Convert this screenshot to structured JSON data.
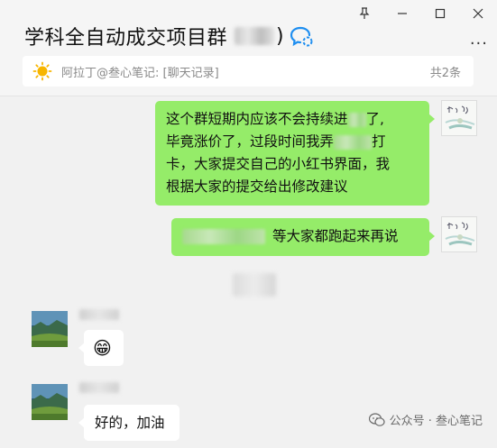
{
  "window": {
    "controls": [
      "pin-icon",
      "minimize-icon",
      "maximize-icon",
      "close-icon"
    ]
  },
  "header": {
    "title": "学科全自动成交项目群",
    "title_suffix": ")",
    "more": "···"
  },
  "pinned": {
    "text": "阿拉丁@叁心笔记: [聊天记录]",
    "count": "共2条"
  },
  "messages": [
    {
      "side": "right",
      "segments": [
        "这个群短期内应该不会持续进",
        "了,",
        "毕竟涨价了，过段时间我弄",
        "打",
        "卡，大家提交自己的小红书界面，我",
        "根据大家的提交给出修改建议"
      ]
    },
    {
      "side": "right",
      "text": "等大家都跑起来再说"
    },
    {
      "side": "left",
      "text": "😁"
    },
    {
      "side": "left",
      "text": "好的，加油"
    }
  ],
  "watermark": {
    "text": "公众号 · 叁心笔记"
  },
  "colors": {
    "bubble_mine": "#95ec69",
    "bubble_other": "#ffffff",
    "background": "#f1f1f1"
  }
}
